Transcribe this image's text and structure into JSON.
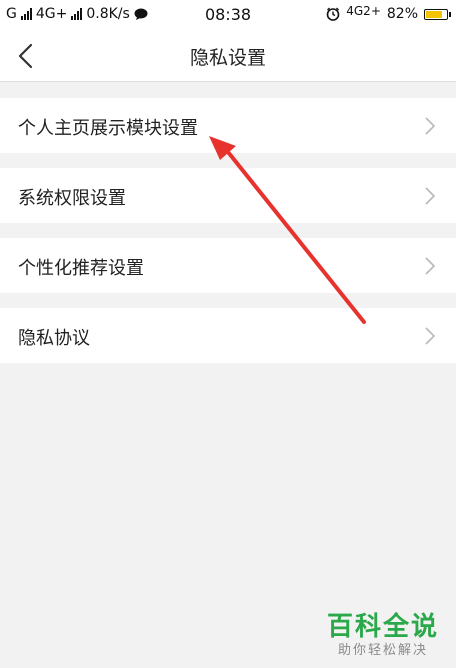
{
  "status_bar": {
    "carrier1": "G",
    "network": "4G+",
    "speed": "0.8K/s",
    "time": "08:38",
    "network2": "4G2+",
    "battery_percent": "82%",
    "battery_level": 0.82,
    "battery_color": "#f5c400",
    "icons": [
      "signal-icon",
      "signal-icon",
      "chat-bubble-icon",
      "alarm-icon",
      "battery-icon"
    ]
  },
  "nav": {
    "title": "隐私设置",
    "back_icon": "chevron-left-icon"
  },
  "menu": {
    "items": [
      {
        "label": "个人主页展示模块设置"
      },
      {
        "label": "系统权限设置"
      },
      {
        "label": "个性化推荐设置"
      },
      {
        "label": "隐私协议"
      }
    ]
  },
  "annotation": {
    "arrow_color": "#e8322d"
  },
  "watermark": {
    "line1": "百科全说",
    "line2": "助你轻松解决",
    "color": "#2aa84a"
  }
}
